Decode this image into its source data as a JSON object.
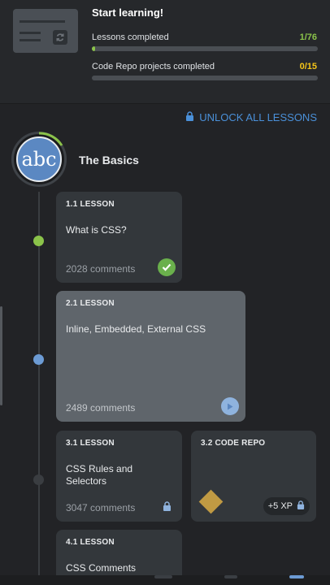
{
  "header": {
    "title": "Start learning!",
    "lessons": {
      "label": "Lessons completed",
      "count": "1/76",
      "progress": 0.013,
      "color": "#8bc34a"
    },
    "projects": {
      "label": "Code Repo projects completed",
      "count": "0/15",
      "progress": 0.0,
      "color": "#f5c518"
    }
  },
  "unlock": {
    "label": "UNLOCK ALL LESSONS",
    "icon": "lock-icon",
    "color": "#4a90d9"
  },
  "module": {
    "avatar_text": "abc",
    "title": "The Basics"
  },
  "cards": [
    {
      "kicker": "1.1 LESSON",
      "title": "What is CSS?",
      "comments": "2028 comments",
      "status": "completed",
      "status_color": "#6ab04c"
    },
    {
      "kicker": "2.1 LESSON",
      "title": "Inline, Embedded, External CSS",
      "comments": "2489 comments",
      "status": "play",
      "status_color": "#6c9bd4"
    },
    {
      "kicker": "3.1 LESSON",
      "title": "CSS Rules and Selectors",
      "comments": "3047 comments",
      "status": "locked"
    },
    {
      "kicker": "3.2 CODE REPO",
      "xp": "+5 XP",
      "status": "locked"
    },
    {
      "kicker": "4.1 LESSON",
      "title": "CSS Comments"
    }
  ]
}
